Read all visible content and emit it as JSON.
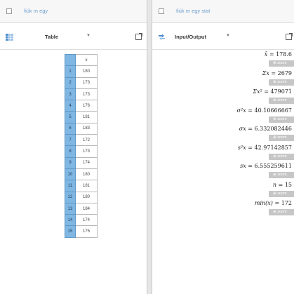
{
  "left_panel": {
    "title": "fiúk m egy",
    "view_label": "Table",
    "column_header": "x",
    "rows": [
      {
        "index": "1",
        "value": "180"
      },
      {
        "index": "2",
        "value": "173"
      },
      {
        "index": "3",
        "value": "173"
      },
      {
        "index": "4",
        "value": "176"
      },
      {
        "index": "5",
        "value": "181"
      },
      {
        "index": "6",
        "value": "183"
      },
      {
        "index": "7",
        "value": "172"
      },
      {
        "index": "8",
        "value": "173"
      },
      {
        "index": "9",
        "value": "174"
      },
      {
        "index": "10",
        "value": "180"
      },
      {
        "index": "11",
        "value": "181"
      },
      {
        "index": "12",
        "value": "180"
      },
      {
        "index": "13",
        "value": "184"
      },
      {
        "index": "14",
        "value": "174"
      },
      {
        "index": "15",
        "value": "175"
      }
    ]
  },
  "right_panel": {
    "title": "fiúk m egy stat",
    "view_label": "Input/Output",
    "zoom_label": "zoom",
    "stats": [
      {
        "lhs": "x̄",
        "rhs": "178.6"
      },
      {
        "lhs": "Σx",
        "rhs": "2679"
      },
      {
        "lhs": "Σx²",
        "rhs": "479071"
      },
      {
        "lhs": "σ²x",
        "rhs": "40.10666667"
      },
      {
        "lhs": "σx",
        "rhs": "6.332082446"
      },
      {
        "lhs": "s²x",
        "rhs": "42.97142857"
      },
      {
        "lhs": "sx",
        "rhs": "6.555259611"
      },
      {
        "lhs": "n",
        "rhs": "15"
      },
      {
        "lhs": "min(x)",
        "rhs": "172"
      }
    ]
  },
  "colors": {
    "accent": "#7fb6e2",
    "title_text": "#6f9fd0",
    "zoom_button": "#c6c6c6"
  }
}
